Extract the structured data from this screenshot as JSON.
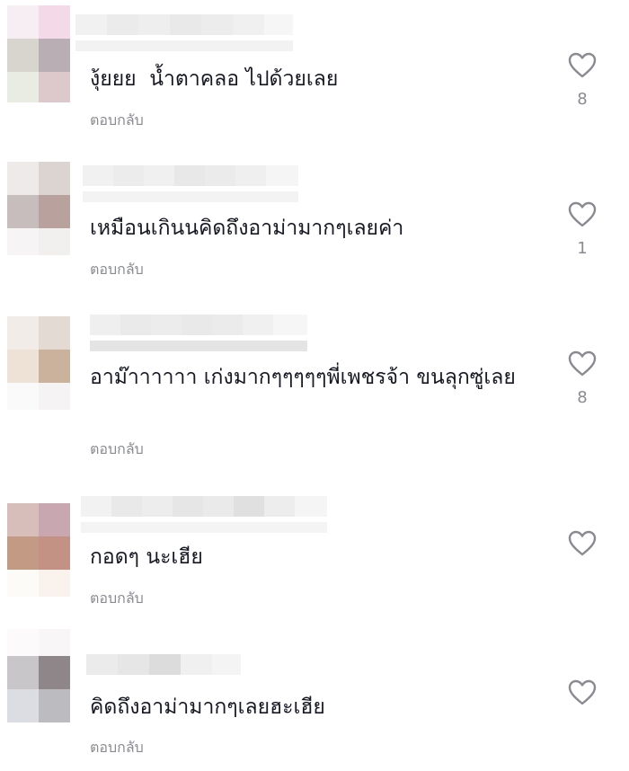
{
  "comments": [
    {
      "text": "งุ้ยยย  น้ำตาคลอ ไปด้วยเลย",
      "reply_label": "ตอบกลับ",
      "likes": "8",
      "icon": "heart-outline-icon"
    },
    {
      "text": "เหมือนเกินนคิดถึงอาม่ามากๆเลยค่า",
      "reply_label": "ตอบกลับ",
      "likes": "1",
      "icon": "heart-outline-icon"
    },
    {
      "text": "อาม๊าาาาาา เก่งมากๆๆๆๆๆพี่เพชรจ้า ขนลุกซู่เลย",
      "reply_label": "ตอบกลับ",
      "likes": "8",
      "icon": "heart-outline-icon"
    },
    {
      "text": "กอดๆ นะเฮีย",
      "reply_label": "ตอบกลับ",
      "likes": "",
      "icon": "heart-outline-icon"
    },
    {
      "text": "คิดถึงอาม่ามากๆเลยฮะเฮีย",
      "reply_label": "ตอบกลับ",
      "likes": "",
      "icon": "heart-outline-icon"
    }
  ],
  "colors": {
    "text": "#161823",
    "secondary": "#8a8b91",
    "heart_stroke": "#8a8b91"
  }
}
